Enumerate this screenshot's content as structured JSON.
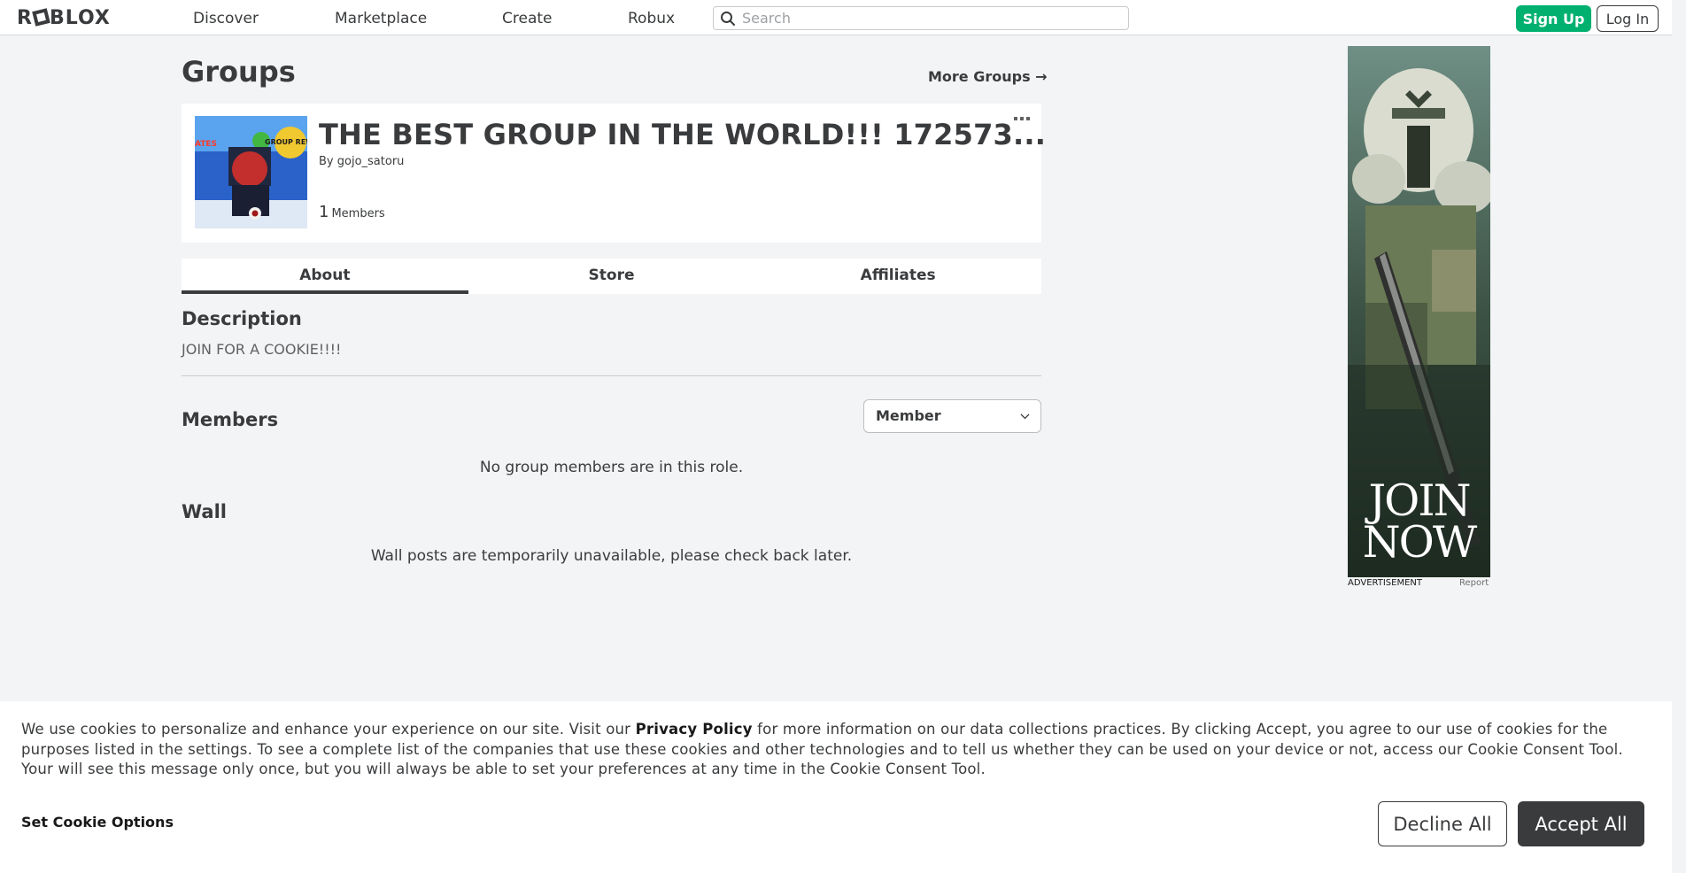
{
  "header": {
    "logo": "ROBLOX",
    "nav": [
      "Discover",
      "Marketplace",
      "Create",
      "Robux"
    ],
    "search_placeholder": "Search",
    "signup_label": "Sign Up",
    "login_label": "Log In",
    "colors": {
      "signup": "#00b06f"
    }
  },
  "page": {
    "title": "Groups",
    "more_groups": "More Groups →"
  },
  "group": {
    "name": "THE BEST GROUP IN THE WORLD!!! 172573...",
    "owner_prefix": "By",
    "owner": "gojo_satoru",
    "member_count": "1",
    "member_label": "Members",
    "emblem_text": "GROUP REW",
    "emblem_side_text": "ATES"
  },
  "tabs": [
    "About",
    "Store",
    "Affiliates"
  ],
  "active_tab": "About",
  "about": {
    "description_heading": "Description",
    "description": "JOIN FOR A COOKIE!!!!",
    "members_heading": "Members",
    "role_selected": "Member",
    "members_empty": "No group members are in this role.",
    "wall_heading": "Wall",
    "wall_empty": "Wall posts are temporarily unavailable, please check back later."
  },
  "ad": {
    "headline_line1": "JOIN",
    "headline_line2": "NOW",
    "label": "ADVERTISEMENT",
    "report": "Report"
  },
  "cookie": {
    "text_before": "We use cookies to personalize and enhance your experience on our site. Visit our ",
    "privacy_link": "Privacy Policy",
    "text_after": " for more information on our data collections practices. By clicking Accept, you agree to our use of cookies for the purposes listed in the settings. To see a complete list of the companies that use these cookies and other technologies and to tell us whether they can be used on your device or not, access our Cookie Consent Tool. Your will see this message only once, but you will always be able to set your preferences at any time in the Cookie Consent Tool.",
    "set_options": "Set Cookie Options",
    "decline": "Decline All",
    "accept": "Accept All"
  }
}
